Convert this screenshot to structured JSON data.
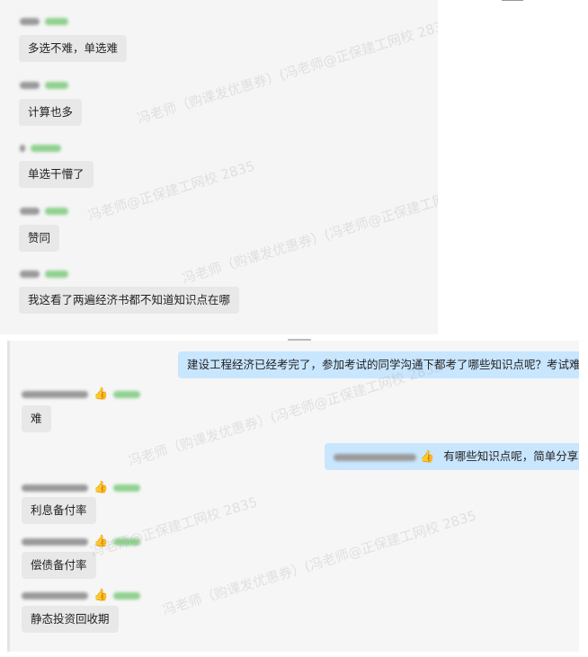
{
  "top_chat": {
    "messages": [
      {
        "text": "多选不难，单选难"
      },
      {
        "text": "计算也多"
      },
      {
        "text": "单选干懵了"
      },
      {
        "text": "赞同"
      },
      {
        "text": "我这看了两遍经济书都不知道知识点在哪"
      }
    ]
  },
  "bottom_chat": {
    "question": "建设工程经济已经考完了，参加考试的同学沟通下都考了哪些知识点呢？考试难不难?",
    "reply_hard": "难",
    "follow_up": "有哪些知识点呢，简单分享下",
    "answers": [
      "利息备付率",
      "偿债备付率",
      "静态投资回收期"
    ]
  },
  "watermarks": [
    "冯老师（购课发优惠券）(冯老师@正保建工网校 2835",
    "冯老师@正保建工网校 2835",
    "冯老师（购课发优惠券）(冯老师@正保建工网校 2835"
  ],
  "colors": {
    "panel_bg": "#f5f5f5",
    "incoming_bubble": "#e8e8e8",
    "outgoing_bubble": "#c9e6ff",
    "blurred_name": "#9a9a9a",
    "blurred_tag": "#8fd18f"
  },
  "icons": [
    "thumbs-up-icon"
  ]
}
